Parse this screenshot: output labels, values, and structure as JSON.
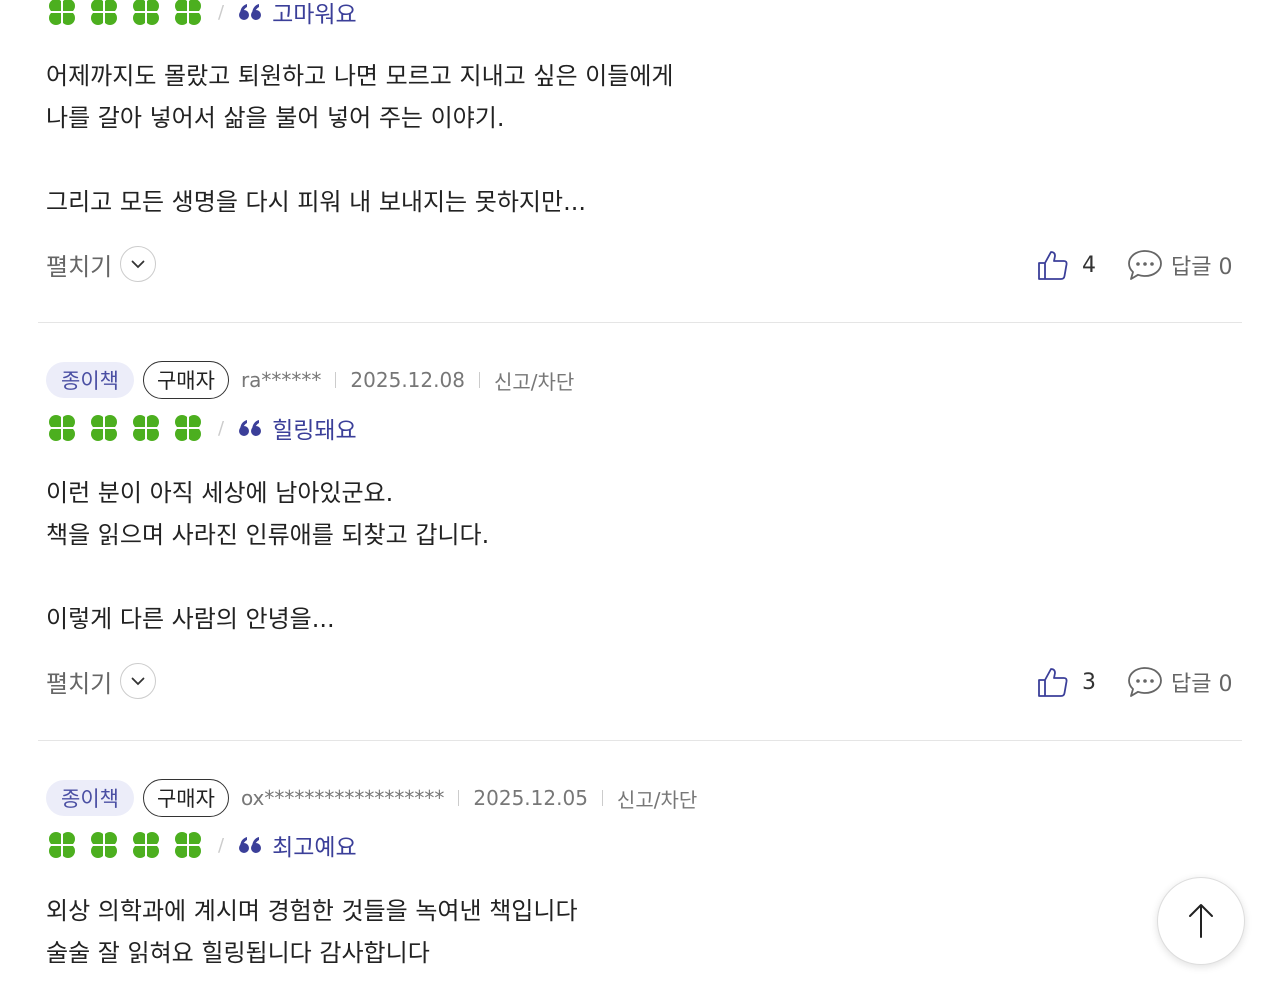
{
  "reviews": [
    {
      "format": "",
      "buyer_badge": "",
      "user": "",
      "date": "",
      "report": "",
      "rating_of_4": 4,
      "tag": "고마워요",
      "body_lines": [
        "어제까지도 몰랐고 퇴원하고 나면 모르고 지내고 싶은 이들에게",
        "나를 갈아 넣어서 삶을 불어 넣어 주는 이야기.",
        "",
        "그리고 모든 생명을 다시 피워 내 보내지는 못하지만..."
      ],
      "expand_label": "펼치기",
      "like_count": "4",
      "reply_label": "답글 0"
    },
    {
      "format": "종이책",
      "buyer_badge": "구매자",
      "user": "ra******",
      "date": "2025.12.08",
      "report": "신고/차단",
      "rating_of_4": 4,
      "tag": "힐링돼요",
      "body_lines": [
        "이런 분이 아직 세상에 남아있군요.",
        "책을 읽으며 사라진 인류애를 되찾고 갑니다.",
        "",
        "이렇게 다른 사람의 안녕을..."
      ],
      "expand_label": "펼치기",
      "like_count": "3",
      "reply_label": "답글 0"
    },
    {
      "format": "종이책",
      "buyer_badge": "구매자",
      "user": "ox******************",
      "date": "2025.12.05",
      "report": "신고/차단",
      "rating_of_4": 4,
      "tag": "최고예요",
      "body_lines": [
        "외상 의학과에 계시며 경험한 것들을 녹여낸 책입니다",
        "술술 잘 읽혀요 힐링됩니다 감사합니다"
      ]
    }
  ],
  "icons": {
    "rating": "clover-icon",
    "tag": "quote-icon",
    "expand": "chevron-down-icon",
    "like": "thumbs-up-icon",
    "reply": "speech-bubble-icon",
    "scroll_top": "arrow-up-icon"
  },
  "colors": {
    "clover": "#4caf1f",
    "tag": "#3b3f99",
    "format_chip_bg": "#ecedf9",
    "format_chip_text": "#4a4fa3"
  }
}
